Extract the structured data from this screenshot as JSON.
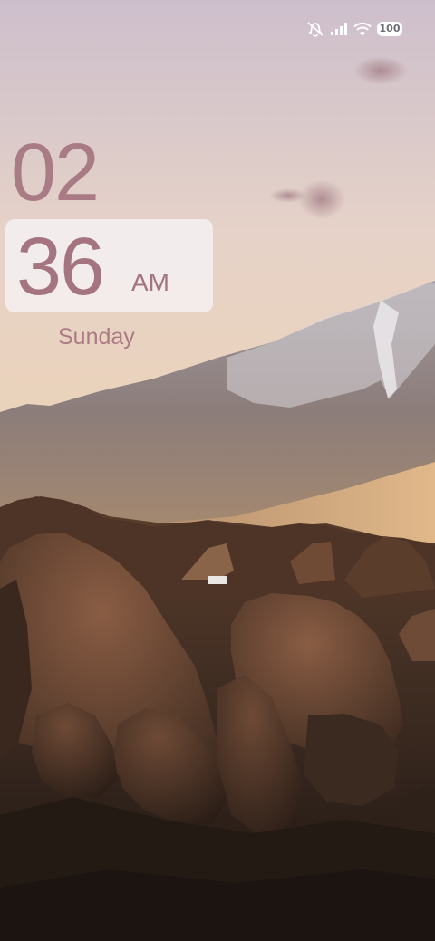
{
  "status_bar": {
    "icons": [
      "mute-icon",
      "signal-icon",
      "wifi-icon"
    ],
    "battery_level": "100"
  },
  "clock": {
    "hours": "02",
    "minutes": "36",
    "ampm": "AM",
    "day": "Sunday"
  },
  "colors": {
    "clock_text": "#a97b84",
    "card_bg": "#f4eef0"
  }
}
